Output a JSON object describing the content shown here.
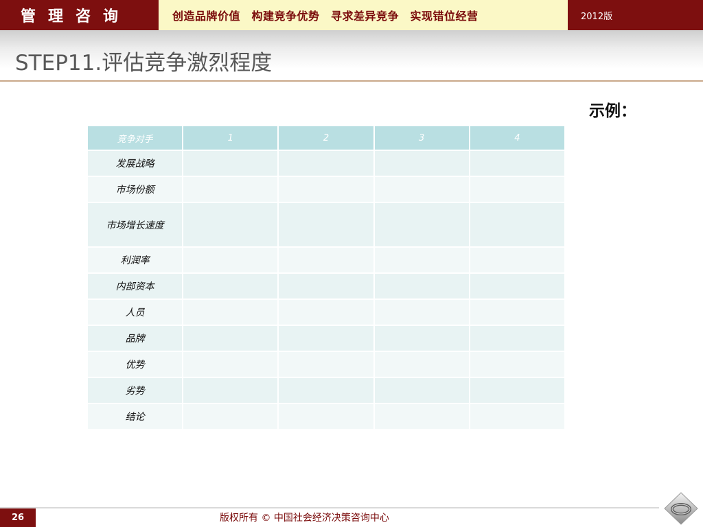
{
  "header": {
    "brand": "管理咨询",
    "slogan": "创造品牌价值　构建竞争优势　寻求差异竞争　实现错位经营",
    "version": "2012版"
  },
  "page": {
    "title": "STEP11.评估竞争激烈程度",
    "example_label": "示例："
  },
  "table": {
    "headers": [
      "竞争对手",
      "1",
      "2",
      "3",
      "4"
    ],
    "rows": [
      {
        "label": "发展战略",
        "cells": [
          "",
          "",
          "",
          ""
        ]
      },
      {
        "label": "市场份额",
        "cells": [
          "",
          "",
          "",
          ""
        ]
      },
      {
        "label": "市场增长速度",
        "cells": [
          "",
          "",
          "",
          ""
        ]
      },
      {
        "label": "利润率",
        "cells": [
          "",
          "",
          "",
          ""
        ]
      },
      {
        "label": "内部资本",
        "cells": [
          "",
          "",
          "",
          ""
        ]
      },
      {
        "label": "人员",
        "cells": [
          "",
          "",
          "",
          ""
        ]
      },
      {
        "label": "品牌",
        "cells": [
          "",
          "",
          "",
          ""
        ]
      },
      {
        "label": "优势",
        "cells": [
          "",
          "",
          "",
          ""
        ]
      },
      {
        "label": "劣势",
        "cells": [
          "",
          "",
          "",
          ""
        ]
      },
      {
        "label": "结论",
        "cells": [
          "",
          "",
          "",
          ""
        ]
      }
    ]
  },
  "footer": {
    "page_number": "26",
    "copyright": "版权所有 © 中国社会经济决策咨询中心"
  },
  "colors": {
    "brand_red": "#7d0f0f",
    "slogan_bg": "#fbf8c6",
    "table_header": "#b9dfe2",
    "table_row": "#e8f3f3"
  },
  "icons": {
    "logo": "diamond-ring-logo-icon"
  }
}
